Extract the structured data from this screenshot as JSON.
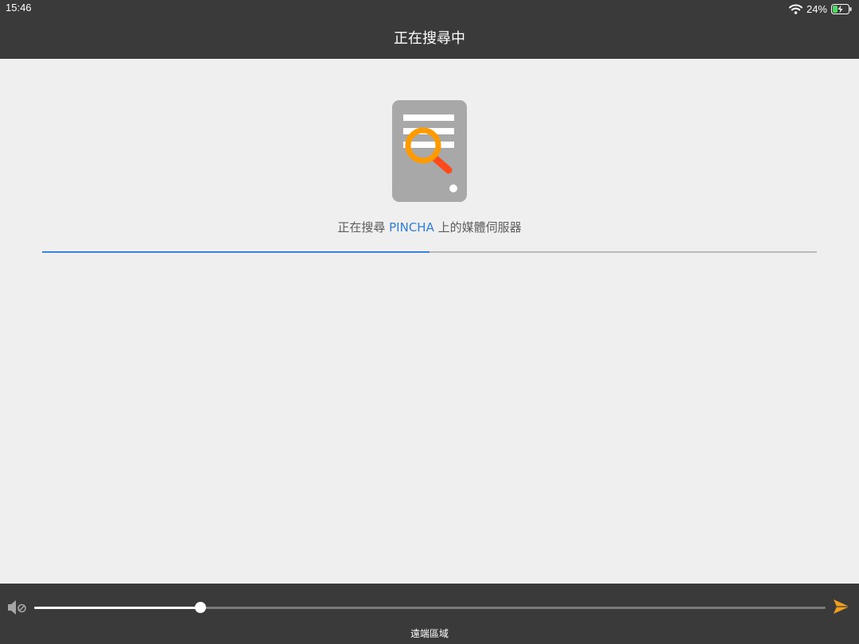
{
  "status_bar": {
    "time": "15:46",
    "battery": "24%",
    "wifi_icon": "wifi-icon",
    "battery_icon": "battery-charging-icon"
  },
  "nav": {
    "title": "正在搜尋中"
  },
  "search": {
    "icon": "server-search-icon",
    "prefix": "正在搜尋 ",
    "server_name": "PINCHA",
    "suffix": " 上的媒體伺服器",
    "progress": 0.5
  },
  "player": {
    "mute_icon": "volume-mute-icon",
    "volume": 0.21,
    "send_icon": "send-icon",
    "zone_label": "遠端區域"
  },
  "colors": {
    "bar_background": "#3a3a3a",
    "page_background": "#efefef",
    "accent": "#3c82d8",
    "server_name": "#2f7fd6",
    "send_icon": "#f0a020",
    "magnifier": "#ff8a00"
  }
}
